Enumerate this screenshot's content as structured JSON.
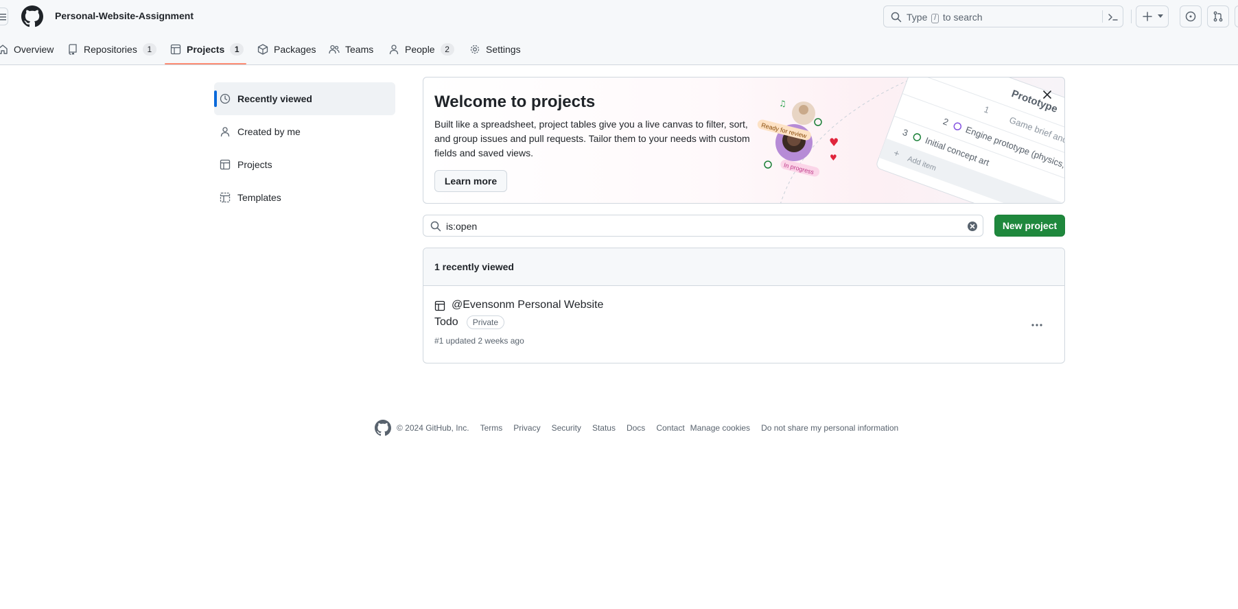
{
  "header": {
    "org_name": "Personal-Website-Assignment",
    "search_prefix": "Type",
    "search_key": "/",
    "search_suffix": "to search"
  },
  "nav": {
    "overview": "Overview",
    "repositories": "Repositories",
    "repositories_count": "1",
    "projects": "Projects",
    "projects_count": "1",
    "packages": "Packages",
    "teams": "Teams",
    "people": "People",
    "people_count": "2",
    "settings": "Settings"
  },
  "sidebar": {
    "items": [
      {
        "label": "Recently viewed",
        "icon": "clock-icon"
      },
      {
        "label": "Created by me",
        "icon": "person-icon"
      },
      {
        "label": "Projects",
        "icon": "table-icon"
      },
      {
        "label": "Templates",
        "icon": "template-icon"
      }
    ]
  },
  "banner": {
    "title": "Welcome to projects",
    "description": "Built like a spreadsheet, project tables give you a live canvas to filter, sort, and group issues and pull requests. Tailor them to your needs with custom fields and saved views.",
    "learn_more": "Learn more",
    "illus_prototype": "Prototype",
    "illus_row1_num": "1",
    "illus_row1": "Game brief and go-no",
    "illus_row2_num": "2",
    "illus_row2": "Engine prototype (physics, renderin",
    "illus_row3_num": "3",
    "illus_row3": "Initial concept art",
    "illus_add": "Add item",
    "illus_ready": "Ready for review",
    "illus_progress": "In progress"
  },
  "filter": {
    "query": "is:open",
    "new_project": "New project"
  },
  "list": {
    "header": "1 recently viewed",
    "items": [
      {
        "title": "@Evensonm Personal Website",
        "subtitle": "Todo",
        "visibility": "Private",
        "meta": "#1 updated 2 weeks ago"
      }
    ]
  },
  "footer": {
    "copyright": "© 2024 GitHub, Inc.",
    "links": [
      "Terms",
      "Privacy",
      "Security",
      "Status",
      "Docs",
      "Contact",
      "Manage cookies",
      "Do not share my personal information"
    ]
  },
  "colors": {
    "accent": "#0969da",
    "primary_button": "#1f883d",
    "nav_underline": "#fd8c73"
  }
}
